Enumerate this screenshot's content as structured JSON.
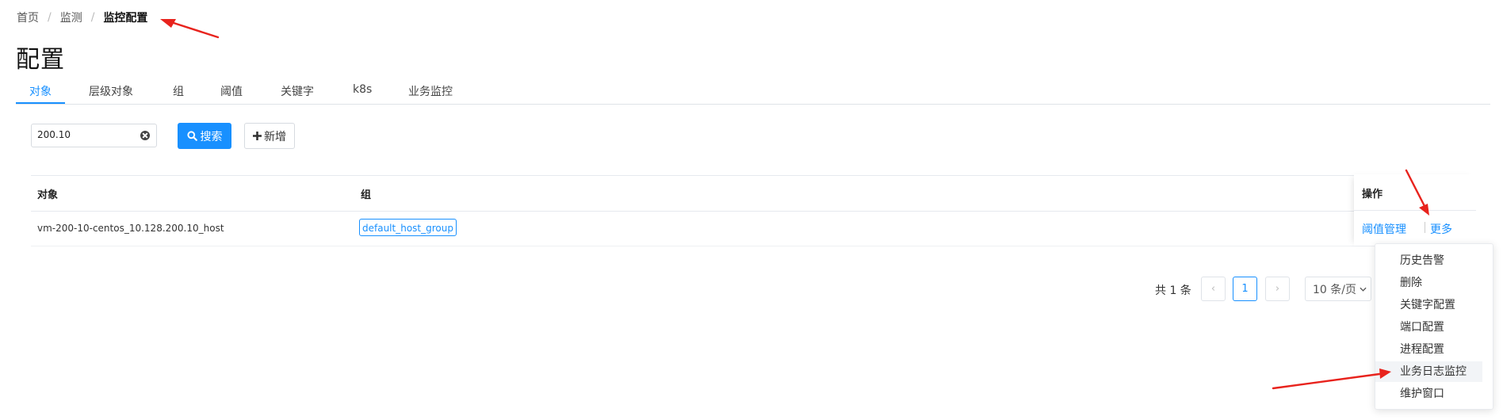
{
  "breadcrumb": {
    "items": [
      "首页",
      "监测",
      "监控配置"
    ],
    "separator": "/"
  },
  "page": {
    "title": "配置"
  },
  "tabs": [
    {
      "label": "对象",
      "active": true
    },
    {
      "label": "层级对象",
      "active": false
    },
    {
      "label": "组",
      "active": false
    },
    {
      "label": "阈值",
      "active": false
    },
    {
      "label": "关键字",
      "active": false
    },
    {
      "label": "k8s",
      "active": false
    },
    {
      "label": "业务监控",
      "active": false
    }
  ],
  "toolbar": {
    "search_value": "200.10",
    "search_label": "搜索",
    "add_label": "新增",
    "search_icon": "search-icon",
    "add_icon": "plus-icon",
    "clear_icon": "clear-icon"
  },
  "table": {
    "columns": [
      "对象",
      "组",
      "操作"
    ],
    "rows": [
      {
        "object": "vm-200-10-centos_10.128.200.10_host",
        "group": "default_host_group",
        "actions": [
          "阈值管理",
          "更多"
        ]
      }
    ]
  },
  "pagination": {
    "total_text": "共 1 条",
    "prev": "‹",
    "next": "›",
    "current_page": "1",
    "page_size": "10 条/页"
  },
  "more_menu": {
    "items": [
      "历史告警",
      "删除",
      "关键字配置",
      "端口配置",
      "进程配置",
      "业务日志监控",
      "维护窗口"
    ],
    "highlighted": "业务日志监控"
  },
  "colors": {
    "primary": "#1890ff",
    "annotation": "#e8231d",
    "border": "#dfe3e8"
  }
}
